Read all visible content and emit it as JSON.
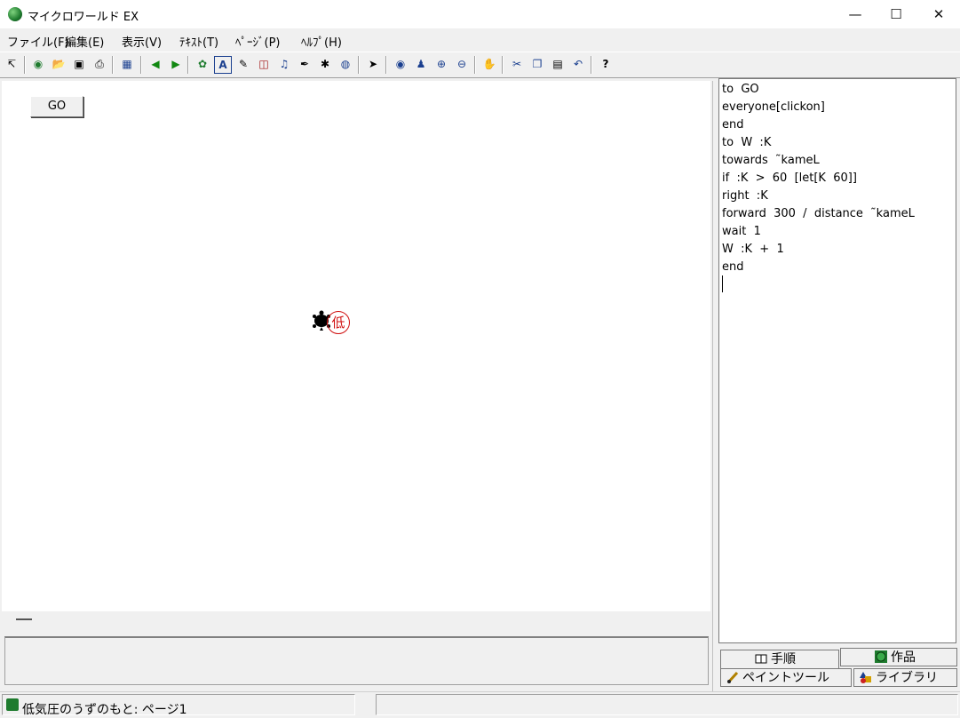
{
  "window": {
    "title": "マイクロワールド EX",
    "minimize": "—",
    "maximize": "☐",
    "close": "✕"
  },
  "menu": [
    "ファイル(F)",
    "編集(E)",
    "表示(V)",
    "ﾃｷｽﾄ(T)",
    "ﾍﾟｰｼﾞ(P)",
    "ﾍﾙﾌﾟ(H)"
  ],
  "toolbar": {
    "icons": [
      "pointer-arrow-icon",
      "globe-icon",
      "open-folder-icon",
      "save-disk-icon",
      "print-icon",
      "page-layout-icon",
      "back-arrow-icon",
      "forward-arrow-icon",
      "turtle-icon",
      "text-box-icon",
      "paint-tool-icon",
      "button-tool-icon",
      "music-icon",
      "slider-tool-icon",
      "movie-icon",
      "globe-stamp-icon",
      "cursor-icon",
      "eye-icon",
      "stamp-icon",
      "zoom-in-icon",
      "zoom-out-icon",
      "stop-icon",
      "scissors-icon",
      "copy-icon",
      "paste-icon",
      "undo-icon",
      "help-icon"
    ],
    "glyphs": [
      "↸",
      "◉",
      "📂",
      "▣",
      "⎙",
      "▦",
      "◀",
      "▶",
      "✿",
      "A",
      "✎",
      "◫",
      "♫",
      "✒",
      "✱",
      "◍",
      "➤",
      "◉",
      "♟",
      "⊕",
      "⊖",
      "✋",
      "✂",
      "❐",
      "▤",
      "↶",
      "?"
    ]
  },
  "canvas": {
    "go_button": "GO",
    "stamp_char": "低"
  },
  "procedures": {
    "lines": [
      "to  GO",
      "everyone[clickon]",
      "end",
      "to  W  :K",
      "towards  ˜kameL",
      "if  :K  >  60  [let[K  60]]",
      "right  :K",
      "forward  300  /  distance  ˜kameL",
      "wait  1",
      "W  :K  +  1",
      "end"
    ]
  },
  "tabs": {
    "procedures": "手順",
    "project": "作品",
    "paint_tools": "ペイントツール",
    "library": "ライブラリ"
  },
  "status": {
    "text": "低気圧のうずのもと: ページ1"
  }
}
